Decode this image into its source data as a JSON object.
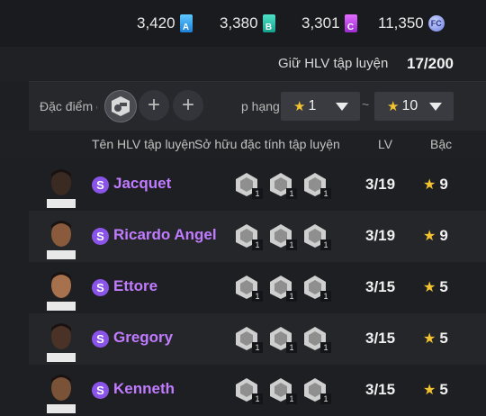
{
  "currencies": [
    {
      "value": "3,420",
      "badge": "A",
      "color": "#3aa6f2",
      "icon": "gem-a-icon"
    },
    {
      "value": "3,380",
      "badge": "B",
      "color": "#2cc7ae",
      "icon": "gem-b-icon"
    },
    {
      "value": "3,301",
      "badge": "C",
      "color": "#c14cf0",
      "icon": "gem-c-icon"
    },
    {
      "value": "11,350",
      "badge": "FC",
      "color": "#8b9cf0",
      "icon": "fc-coin-icon"
    }
  ],
  "hold": {
    "label": "Giữ HLV tập luyện",
    "value": "17/200"
  },
  "filter": {
    "trait_label": "Đặc điểm c",
    "rank_label": "p hạng",
    "rank_min": "1",
    "rank_max": "10",
    "separator": "~"
  },
  "columns": {
    "name": "Tên HLV tập luyện",
    "traits": "Sở hữu đặc tính tập luyện",
    "lv": "LV",
    "grade": "Bậc"
  },
  "coaches": [
    {
      "name": "Jacquet",
      "badge": "S",
      "lv": "3/19",
      "grade": "9",
      "traits": [
        "1",
        "1",
        "1"
      ]
    },
    {
      "name": "Ricardo Angel",
      "badge": "S",
      "lv": "3/19",
      "grade": "9",
      "traits": [
        "1",
        "1",
        "1"
      ]
    },
    {
      "name": "Ettore",
      "badge": "S",
      "lv": "3/15",
      "grade": "5",
      "traits": [
        "1",
        "1",
        "1"
      ]
    },
    {
      "name": "Gregory",
      "badge": "S",
      "lv": "3/15",
      "grade": "5",
      "traits": [
        "1",
        "1",
        "1"
      ]
    },
    {
      "name": "Kenneth",
      "badge": "S",
      "lv": "3/15",
      "grade": "5",
      "traits": [
        "1",
        "1",
        "1"
      ]
    }
  ],
  "accent": {
    "name_color": "#c07bff",
    "star_color": "#f4c430",
    "badge_color": "#8a54e8"
  }
}
